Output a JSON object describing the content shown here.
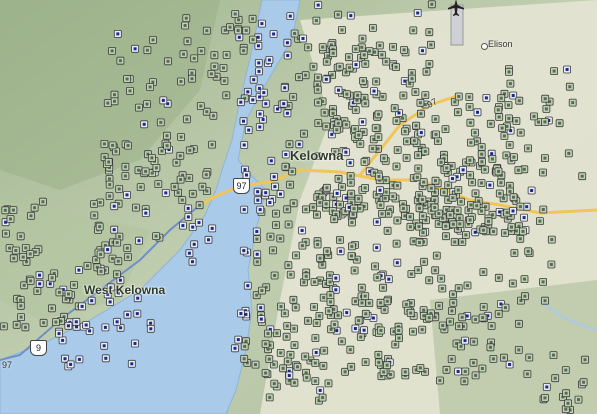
{
  "map": {
    "place_labels": {
      "kelowna": "Kelowna",
      "west_kelowna": "West Kelowna",
      "elison": "Elison"
    },
    "road_labels": {
      "hwy97_shield": "97",
      "hwy97_road_label": "97",
      "hwy97_left_shield": "9",
      "hwy97_left_label": "97"
    },
    "icons": {
      "airport": "airplane-icon",
      "listing_marker": "square-marker-icon"
    },
    "colors": {
      "water": "#a9cbe9",
      "land_east": "#e6e6d4",
      "terrain": "#b6c6a6",
      "forest": "#a7bc96",
      "road": "#f1c55a",
      "marker_green": "#b8ccb0",
      "marker_blue": "#1b2a8c"
    }
  }
}
